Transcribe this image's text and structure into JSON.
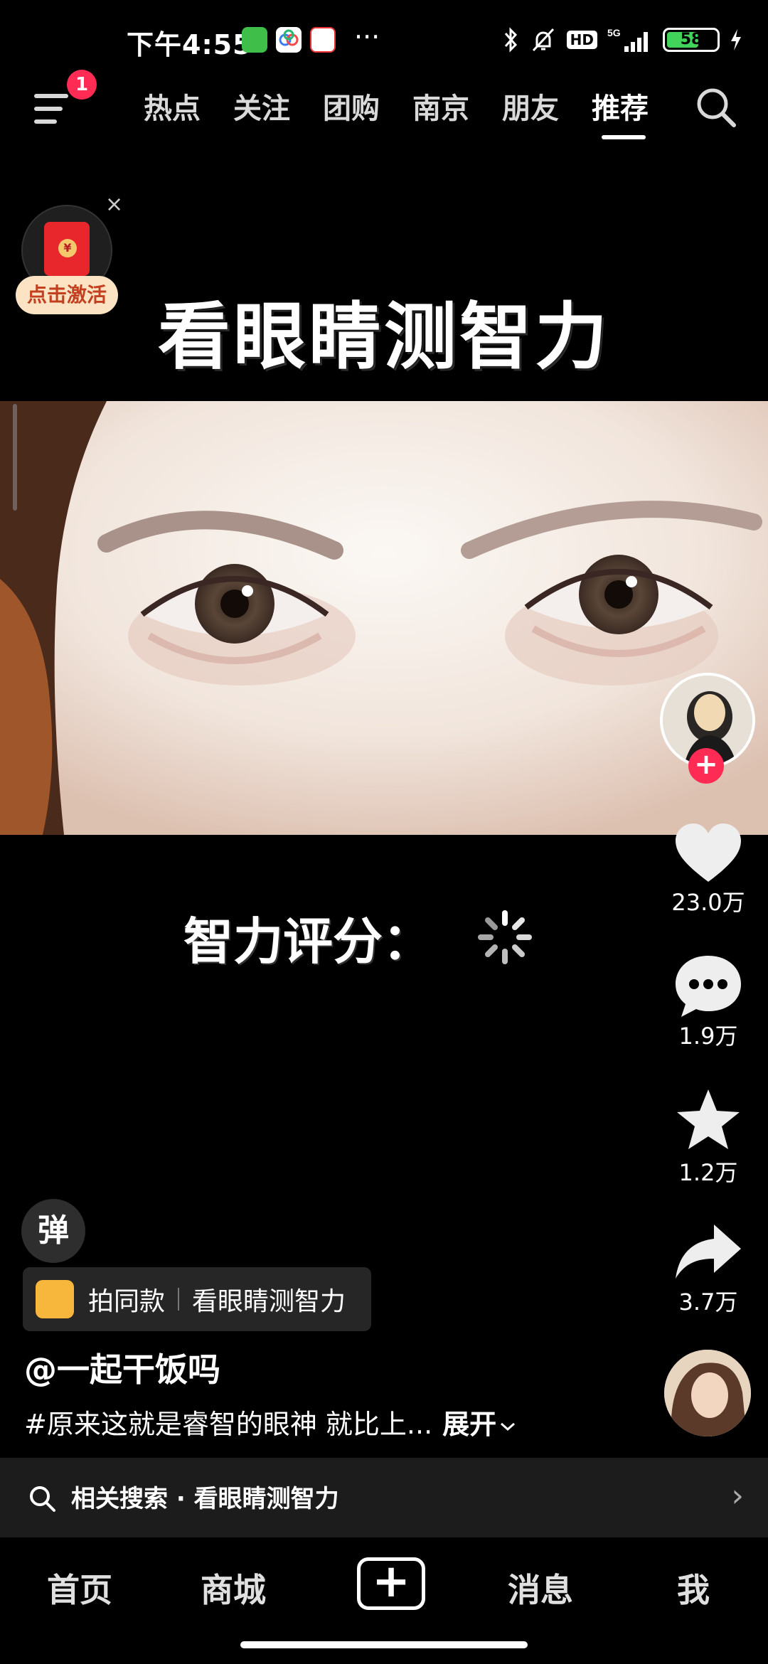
{
  "status_bar": {
    "time": "下午4:55",
    "more": "···",
    "network": "5G",
    "hd": "HD",
    "battery": "58"
  },
  "top_nav": {
    "menu_badge": "1",
    "tabs": [
      "热点",
      "关注",
      "团购",
      "南京",
      "朋友",
      "推荐"
    ],
    "active_tab": "推荐"
  },
  "red_packet": {
    "label": "点击激活",
    "close": "×",
    "coin": "¥"
  },
  "video": {
    "title": "看眼睛测智力",
    "score_label": "智力评分："
  },
  "actions": {
    "follow": "+",
    "likes": "23.0万",
    "comments": "1.9万",
    "favorites": "1.2万",
    "shares": "3.7万"
  },
  "info": {
    "danmu": "弹",
    "same_style_label": "拍同款",
    "same_style_title": "看眼睛测智力",
    "author": "@一起干饭吗",
    "description": "#原来这就是睿智的眼神 就比上...",
    "expand": "展开"
  },
  "related_search": {
    "text": "相关搜索 · 看眼睛测智力",
    "chevron": "›"
  },
  "bottom_nav": {
    "home": "首页",
    "mall": "商城",
    "plus": "+",
    "messages": "消息",
    "me": "我"
  },
  "colors": {
    "accent_red": "#fe2c55",
    "battery_green": "#42d35b",
    "red_packet": "#e8272d"
  },
  "icons": [
    "menu-icon",
    "search-icon",
    "heart-icon",
    "comment-icon",
    "star-icon",
    "share-icon",
    "bluetooth-icon",
    "mute-icon",
    "signal-icon",
    "battery-icon",
    "chevron-right-icon"
  ]
}
